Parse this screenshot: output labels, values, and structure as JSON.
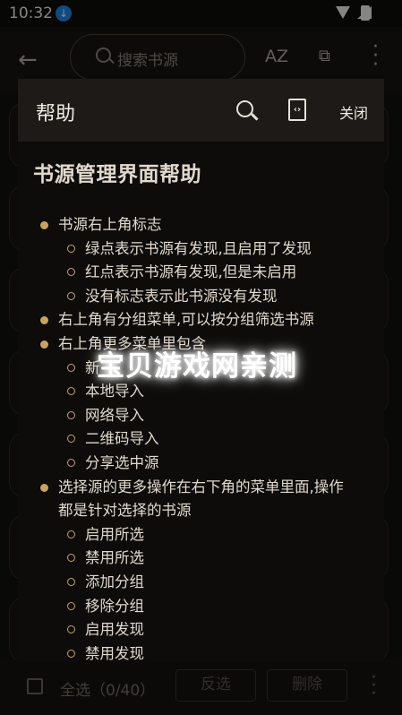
{
  "status_bar": {
    "time": "10:32"
  },
  "app_bar": {
    "search_placeholder": "搜索书源",
    "sort_icon": "AZ"
  },
  "bottom_bar": {
    "select_all": "全选（0/40）",
    "invert": "反选",
    "delete": "删除"
  },
  "dialog": {
    "title": "帮助",
    "close": "关闭",
    "heading": "书源管理界面帮助",
    "items": [
      {
        "level": 1,
        "text": "书源右上角标志"
      },
      {
        "level": 2,
        "text": "绿点表示书源有发现,且启用了发现"
      },
      {
        "level": 2,
        "text": "红点表示书源有发现,但是未启用"
      },
      {
        "level": 2,
        "text": "没有标志表示此书源没有发现"
      },
      {
        "level": 1,
        "text": "右上角有分组菜单,可以按分组筛选书源"
      },
      {
        "level": 1,
        "text": "右上角更多菜单里包含"
      },
      {
        "level": 2,
        "text": "新"
      },
      {
        "level": 2,
        "text": "本地导入"
      },
      {
        "level": 2,
        "text": "网络导入"
      },
      {
        "level": 2,
        "text": "二维码导入"
      },
      {
        "level": 2,
        "text": "分享选中源"
      },
      {
        "level": 1,
        "text": "选择源的更多操作在右下角的菜单里面,操作"
      },
      {
        "level": 0,
        "text": "都是针对选择的书源"
      },
      {
        "level": 2,
        "text": "启用所选"
      },
      {
        "level": 2,
        "text": "禁用所选"
      },
      {
        "level": 2,
        "text": "添加分组"
      },
      {
        "level": 2,
        "text": "移除分组"
      },
      {
        "level": 2,
        "text": "启用发现"
      },
      {
        "level": 2,
        "text": "禁用发现"
      }
    ]
  },
  "watermark": "宝贝游戏网亲测",
  "colors": {
    "accent": "#c9a363",
    "dialog_header": "#1d1a17",
    "dialog_bg": "#0d0c0b"
  }
}
